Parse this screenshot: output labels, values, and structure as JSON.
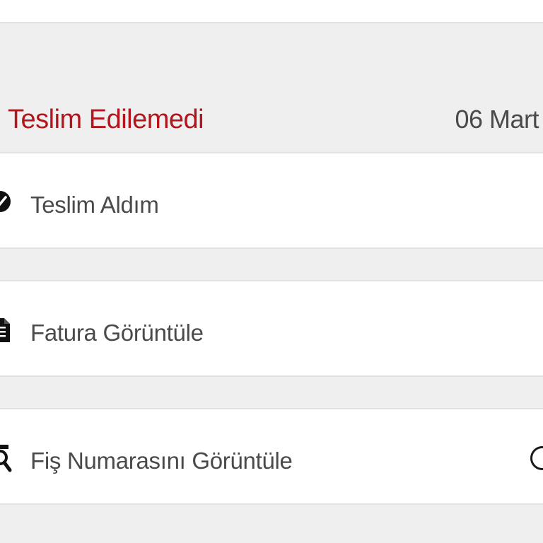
{
  "order_status": {
    "label": "Teslim Edilemedi",
    "date": "06 Mart",
    "label_color": "#b3151c"
  },
  "actions": [
    {
      "label": "Teslim Aldım",
      "icon": "check-circle-icon"
    },
    {
      "label": "Fatura Görüntüle",
      "icon": "document-icon"
    },
    {
      "label": "Fiş Numarasını Görüntüle",
      "icon": "receipt-search-icon",
      "trailing_icon": "info-icon"
    }
  ]
}
